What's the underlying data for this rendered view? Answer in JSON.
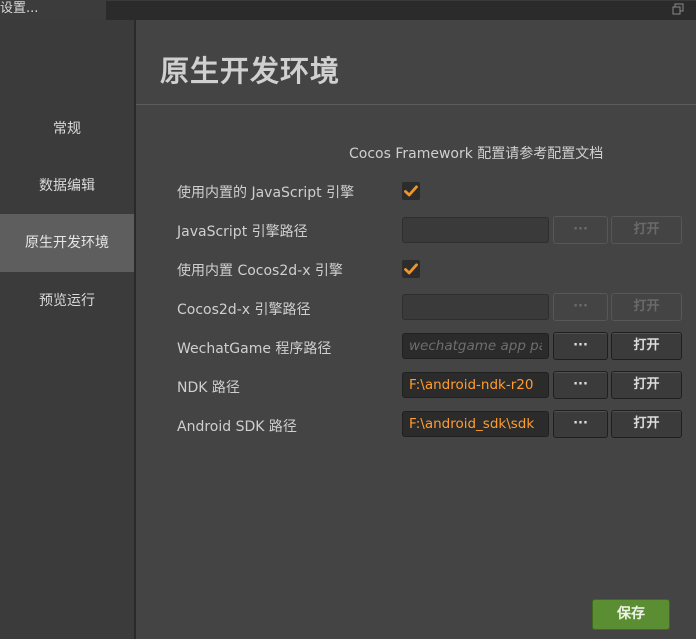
{
  "window": {
    "title": "设置..."
  },
  "sidebar": {
    "items": [
      {
        "label": "常规",
        "active": false
      },
      {
        "label": "数据编辑",
        "active": false
      },
      {
        "label": "原生开发环境",
        "active": true
      },
      {
        "label": "预览运行",
        "active": false
      }
    ]
  },
  "main": {
    "title": "原生开发环境",
    "doc_link": "Cocos Framework 配置请参考配置文档",
    "rows": [
      {
        "label": "使用内置的 JavaScript 引擎",
        "type": "checkbox",
        "checked": true
      },
      {
        "label": "JavaScript 引擎路径",
        "type": "path",
        "value": "",
        "placeholder": "",
        "enabled": false,
        "browse_label": "···",
        "open_label": "打开"
      },
      {
        "label": "使用内置 Cocos2d-x 引擎",
        "type": "checkbox",
        "checked": true
      },
      {
        "label": "Cocos2d-x 引擎路径",
        "type": "path",
        "value": "",
        "placeholder": "",
        "enabled": false,
        "browse_label": "···",
        "open_label": "打开"
      },
      {
        "label": "WechatGame 程序路径",
        "type": "path",
        "value": "",
        "placeholder": "wechatgame app path",
        "enabled": true,
        "browse_label": "···",
        "open_label": "打开"
      },
      {
        "label": "NDK 路径",
        "type": "path",
        "value": "F:\\android-ndk-r20",
        "placeholder": "",
        "enabled": true,
        "browse_label": "···",
        "open_label": "打开"
      },
      {
        "label": "Android SDK 路径",
        "type": "path",
        "value": "F:\\android_sdk\\sdk",
        "placeholder": "",
        "enabled": true,
        "browse_label": "···",
        "open_label": "打开"
      }
    ],
    "save_label": "保存"
  },
  "colors": {
    "accent_orange": "#ff9d2e",
    "save_green": "#5b8d33",
    "active_nav": "#5e5e5e"
  },
  "icons": {
    "checkbox_check": "check-icon",
    "window_restore": "restore-window-icon"
  }
}
